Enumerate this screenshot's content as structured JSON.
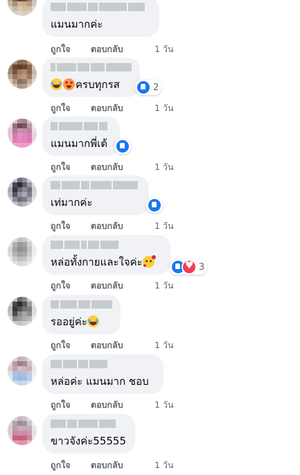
{
  "labels": {
    "like": "ถูกใจ",
    "reply": "ตอบกลับ"
  },
  "comments": [
    {
      "text": "แมนมากค่ะ",
      "emojis": [],
      "reaction_badge": null,
      "reaction_count": "",
      "time": "1 วัน"
    },
    {
      "text": "ครบทุกรส",
      "emojis": [
        "laugh",
        "hearteyes"
      ],
      "reaction_badge": "like",
      "reaction_count": "2",
      "time": "1 วัน"
    },
    {
      "text": "แมนมากพี่เต้",
      "emojis": [],
      "reaction_badge": "like",
      "reaction_count": "",
      "time": "1 วัน"
    },
    {
      "text": "เท่มากค่ะ",
      "emojis": [],
      "reaction_badge": "like",
      "reaction_count": "",
      "time": "1 วัน"
    },
    {
      "text": "หล่อทั้งกายและใจค่ะ",
      "emojis": [
        "inlove"
      ],
      "reaction_badge": "like-love",
      "reaction_count": "3",
      "time": "1 วัน"
    },
    {
      "text": "รออยู่ค่ะ",
      "emojis": [
        "laugh"
      ],
      "reaction_badge": null,
      "reaction_count": "",
      "time": "1 วัน"
    },
    {
      "text": "หล่อค่ะ แมนมาก ชอบ",
      "emojis": [],
      "reaction_badge": null,
      "reaction_count": "",
      "time": "1 วัน"
    },
    {
      "text": "ขาวจังค่ะ55555",
      "emojis": [],
      "reaction_badge": null,
      "reaction_count": "",
      "time": "1 วัน"
    }
  ],
  "icons": {
    "like_badge": "thumbs-up-icon",
    "love_badge": "heart-icon"
  },
  "colors": {
    "bubble": "#f0f2f5",
    "like_blue": "#1877f2",
    "love_red": "#f33e58",
    "meta_gray": "#65676b"
  }
}
